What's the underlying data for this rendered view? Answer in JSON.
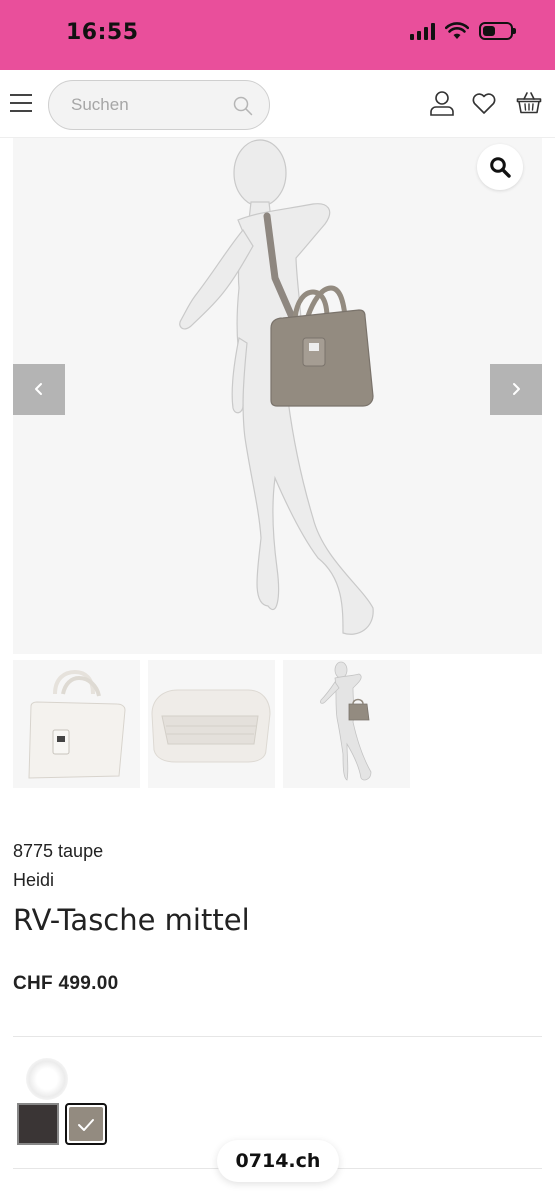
{
  "status_bar": {
    "time": "16:55",
    "background_color": "#e94f9b",
    "battery_level": 0.45
  },
  "header": {
    "menu_icon": "hamburger-icon",
    "search": {
      "placeholder": "Suchen",
      "value": ""
    },
    "icons": [
      "user-icon",
      "heart-icon",
      "basket-icon"
    ]
  },
  "gallery": {
    "zoom_icon": "magnifier-icon",
    "prev_icon": "chevron-left-icon",
    "next_icon": "chevron-right-icon",
    "thumbnails": [
      "handbag-front",
      "handbag-interior",
      "mannequin-with-bag"
    ]
  },
  "product": {
    "article_number": "8775 taupe",
    "collection": "Heidi",
    "name": "RV-Tasche mittel",
    "price": "CHF 499.00",
    "colors": [
      {
        "name": "dark",
        "hex": "#3a3535",
        "selected": false
      },
      {
        "name": "taupe",
        "hex": "#938b80",
        "selected": true
      }
    ]
  },
  "browser": {
    "domain": "0714.ch"
  }
}
